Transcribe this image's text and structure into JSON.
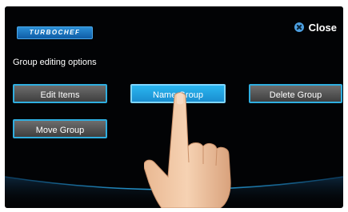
{
  "brand": {
    "logo_text": "TURBOCHEF"
  },
  "header": {
    "close_label": "Close"
  },
  "section": {
    "title": "Group editing options"
  },
  "buttons": {
    "edit_items": "Edit Items",
    "name_group": "Name Group",
    "delete_group": "Delete Group",
    "move_group": "Move Group"
  },
  "colors": {
    "screen_background": "#020305",
    "button_border": "#2faee0",
    "button_fill": "#575757",
    "button_active_fill": "#2ab6f0",
    "accent_arc": "#2aa9e6"
  },
  "icons": {
    "close": "close-circle-icon"
  }
}
